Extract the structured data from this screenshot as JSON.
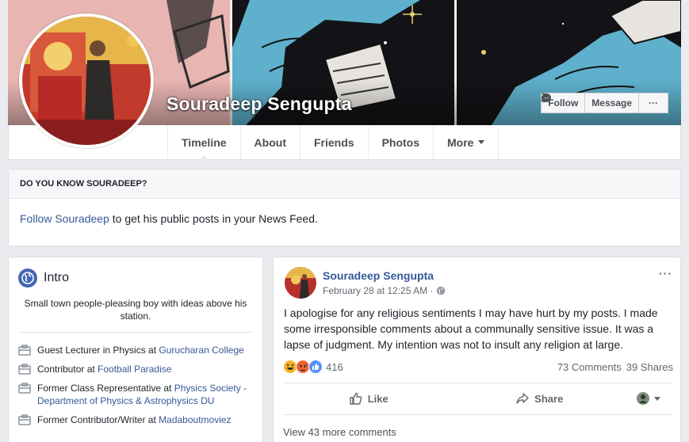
{
  "profile": {
    "name": "Souradeep Sengupta"
  },
  "cover_actions": {
    "follow_label": "Follow",
    "message_label": "Message",
    "more_label": "···"
  },
  "nav": {
    "tabs": [
      {
        "label": "Timeline"
      },
      {
        "label": "About"
      },
      {
        "label": "Friends"
      },
      {
        "label": "Photos"
      },
      {
        "label": "More"
      }
    ]
  },
  "know": {
    "heading": "DO YOU KNOW SOURADEEP?",
    "follow_link": "Follow Souradeep",
    "follow_rest": " to get his public posts in your News Feed."
  },
  "intro": {
    "title": "Intro",
    "bio": "Small town people-pleasing boy with ideas above his station.",
    "items": [
      {
        "prefix": "Guest Lecturer in Physics at ",
        "link": "Gurucharan College"
      },
      {
        "prefix": "Contributor at ",
        "link": "Football Paradise"
      },
      {
        "prefix": "Former Class Representative at ",
        "link": "Physics Society - Department of Physics & Astrophysics DU"
      },
      {
        "prefix": "Former Contributor/Writer at ",
        "link": "Madaboutmoviez"
      }
    ]
  },
  "post": {
    "author": "Souradeep Sengupta",
    "time": "February 28 at 12:25 AM ·",
    "menu": "···",
    "text": "I apologise for any religious sentiments I may have hurt by my posts. I made some irresponsible comments about a communally sensitive issue. It was a lapse of judgment. My intention was not to insult any religion at large.",
    "reaction_count": "416",
    "comments": "73 Comments",
    "shares": "39 Shares",
    "like_label": "Like",
    "share_label": "Share",
    "view_more": "View 43 more comments",
    "colors": {
      "link": "#365899",
      "like_blue": "#5890ff",
      "haha_yellow": "#f7b125",
      "angry_orange": "#f0622d"
    }
  }
}
